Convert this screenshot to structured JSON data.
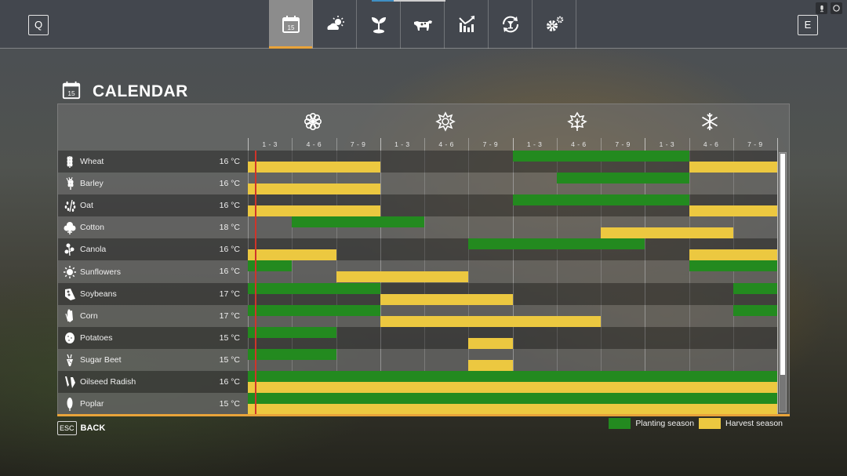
{
  "topbar": {
    "left_key": "Q",
    "right_key": "E",
    "nav_items": [
      {
        "name": "calendar",
        "icon": "calendar-icon",
        "active": true
      },
      {
        "name": "weather",
        "icon": "weather-icon",
        "active": false
      },
      {
        "name": "crops",
        "icon": "sprout-icon",
        "active": false
      },
      {
        "name": "animals",
        "icon": "cow-icon",
        "active": false
      },
      {
        "name": "prices",
        "icon": "chart-icon",
        "active": false
      },
      {
        "name": "production",
        "icon": "cycle-icon",
        "active": false
      },
      {
        "name": "settings",
        "icon": "gears-icon",
        "active": false
      }
    ],
    "system_icons": [
      "microphone-icon",
      "sync-icon"
    ]
  },
  "page": {
    "title": "CALENDAR",
    "calendar_icon_day": "15"
  },
  "seasons": [
    {
      "name": "spring",
      "icon": "flower-icon"
    },
    {
      "name": "summer",
      "icon": "sun-icon"
    },
    {
      "name": "autumn",
      "icon": "leaf-icon"
    },
    {
      "name": "winter",
      "icon": "snowflake-icon"
    }
  ],
  "columns": [
    "1 - 3",
    "4 - 6",
    "7 - 9",
    "1 - 3",
    "4 - 6",
    "7 - 9",
    "1 - 3",
    "4 - 6",
    "7 - 9",
    "1 - 3",
    "4 - 6",
    "7 - 9"
  ],
  "current_period_fraction": 0.16,
  "crops": [
    {
      "name": "Wheat",
      "temp": "16 °C",
      "icon": "wheat-icon",
      "plant": [
        [
          7,
          10
        ]
      ],
      "harvest": [
        [
          1,
          3
        ],
        [
          11,
          12
        ]
      ]
    },
    {
      "name": "Barley",
      "temp": "16 °C",
      "icon": "barley-icon",
      "plant": [
        [
          8,
          10
        ]
      ],
      "harvest": [
        [
          1,
          3
        ]
      ]
    },
    {
      "name": "Oat",
      "temp": "16 °C",
      "icon": "oat-icon",
      "plant": [
        [
          7,
          10
        ]
      ],
      "harvest": [
        [
          1,
          3
        ],
        [
          11,
          12
        ]
      ]
    },
    {
      "name": "Cotton",
      "temp": "18 °C",
      "icon": "cotton-icon",
      "plant": [
        [
          2,
          4
        ]
      ],
      "harvest": [
        [
          9,
          11
        ]
      ]
    },
    {
      "name": "Canola",
      "temp": "16 °C",
      "icon": "canola-icon",
      "plant": [
        [
          6,
          9
        ]
      ],
      "harvest": [
        [
          1,
          2
        ],
        [
          11,
          12
        ]
      ]
    },
    {
      "name": "Sunflowers",
      "temp": "16 °C",
      "icon": "sunflower-icon",
      "plant": [
        [
          1,
          1
        ],
        [
          11,
          12
        ]
      ],
      "harvest": [
        [
          3,
          5
        ]
      ]
    },
    {
      "name": "Soybeans",
      "temp": "17 °C",
      "icon": "soybean-icon",
      "plant": [
        [
          1,
          3
        ],
        [
          12,
          12
        ]
      ],
      "harvest": [
        [
          4,
          6
        ]
      ]
    },
    {
      "name": "Corn",
      "temp": "17 °C",
      "icon": "corn-icon",
      "plant": [
        [
          1,
          3
        ],
        [
          12,
          12
        ]
      ],
      "harvest": [
        [
          4,
          8
        ]
      ]
    },
    {
      "name": "Potatoes",
      "temp": "15 °C",
      "icon": "potato-icon",
      "plant": [
        [
          1,
          2
        ]
      ],
      "harvest": [
        [
          6,
          6
        ]
      ]
    },
    {
      "name": "Sugar Beet",
      "temp": "15 °C",
      "icon": "sugarbeet-icon",
      "plant": [
        [
          1,
          2
        ]
      ],
      "harvest": [
        [
          6,
          6
        ]
      ]
    },
    {
      "name": "Oilseed Radish",
      "temp": "16 °C",
      "icon": "radish-icon",
      "plant": [
        [
          1,
          12
        ]
      ],
      "harvest": [
        [
          1,
          12
        ]
      ]
    },
    {
      "name": "Poplar",
      "temp": "15 °C",
      "icon": "poplar-icon",
      "plant": [
        [
          1,
          12
        ]
      ],
      "harvest": [
        [
          1,
          12
        ]
      ]
    }
  ],
  "legend": {
    "planting_label": "Planting season",
    "harvest_label": "Harvest season",
    "planting_color": "#238a1f",
    "harvest_color": "#ecc840"
  },
  "footer": {
    "esc_key": "ESC",
    "back_label": "BACK"
  },
  "scroll_fraction_visible": 0.86
}
